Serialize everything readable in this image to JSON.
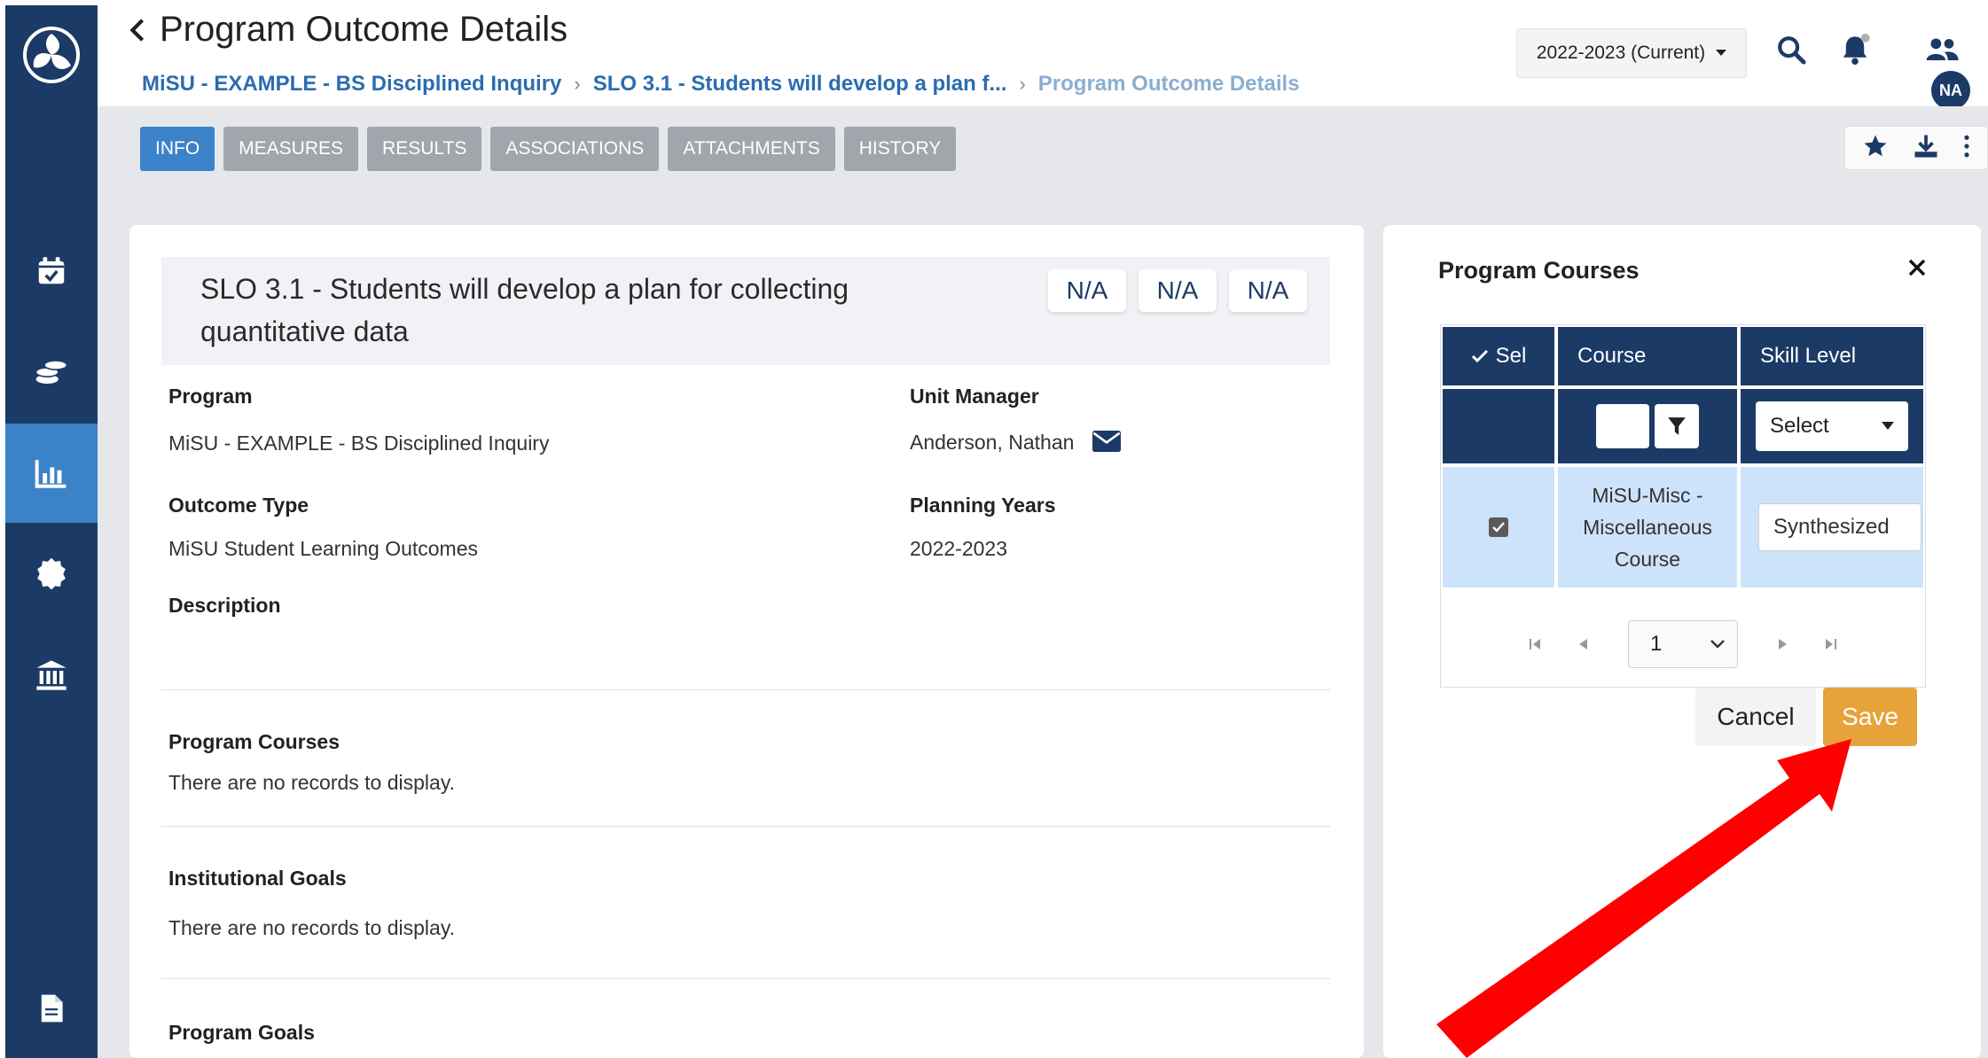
{
  "header": {
    "title": "Program Outcome Details",
    "breadcrumb": [
      "MiSU - EXAMPLE - BS Disciplined Inquiry",
      "SLO 3.1 - Students will develop a plan f...",
      "Program Outcome Details"
    ],
    "year_selector": "2022-2023 (Current)",
    "avatar_initials": "NA"
  },
  "tabs": [
    {
      "label": "INFO",
      "active": true
    },
    {
      "label": "MEASURES"
    },
    {
      "label": "RESULTS"
    },
    {
      "label": "ASSOCIATIONS"
    },
    {
      "label": "ATTACHMENTS"
    },
    {
      "label": "HISTORY"
    }
  ],
  "outcome": {
    "title": "SLO 3.1 - Students will develop a plan for collecting quantitative data",
    "badges": [
      "N/A",
      "N/A",
      "N/A"
    ],
    "program_label": "Program",
    "program_value": "MiSU - EXAMPLE - BS Disciplined Inquiry",
    "unit_manager_label": "Unit Manager",
    "unit_manager_value": "Anderson, Nathan",
    "outcome_type_label": "Outcome Type",
    "outcome_type_value": "MiSU Student Learning Outcomes",
    "planning_years_label": "Planning Years",
    "planning_years_value": "2022-2023",
    "description_label": "Description",
    "program_courses_label": "Program Courses",
    "program_courses_empty": "There are no records to display.",
    "institutional_goals_label": "Institutional Goals",
    "institutional_goals_empty": "There are no records to display.",
    "program_goals_label": "Program Goals"
  },
  "panel": {
    "title": "Program Courses",
    "columns": {
      "sel": "Sel",
      "course": "Course",
      "skill": "Skill Level"
    },
    "skill_filter": "Select",
    "row": {
      "course_lines": [
        "MiSU-Misc -",
        "Miscellaneous",
        "Course"
      ],
      "skill_level": "Synthesized",
      "selected": true
    },
    "page": "1",
    "cancel_label": "Cancel",
    "save_label": "Save"
  },
  "colors": {
    "sidebar": "#1c3a66",
    "accent": "#3b82c9",
    "save": "#e8a23a",
    "annotation_arrow": "#ff0000"
  }
}
